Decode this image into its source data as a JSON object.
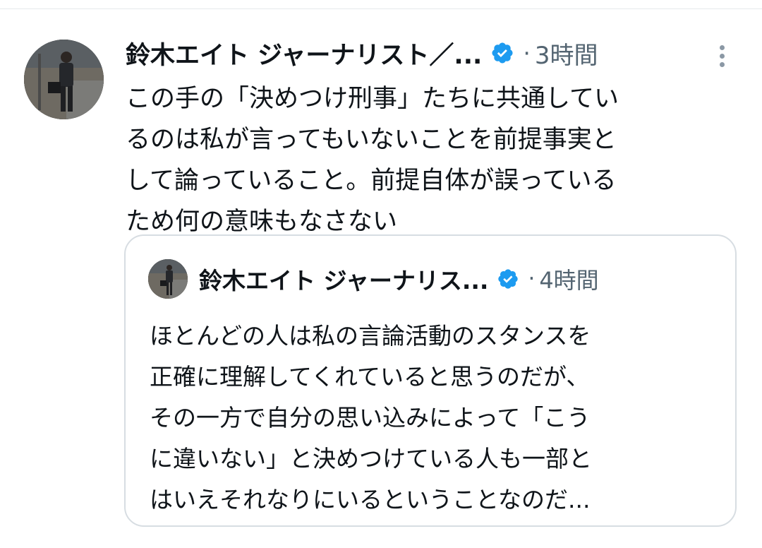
{
  "tweet": {
    "author": {
      "display_name": "鈴木エイト ジャーナリスト／...",
      "avatar_icon": "profile-photo",
      "verified": true
    },
    "separator": "·",
    "timestamp": "3時間",
    "more_icon": "more-vertical-icon",
    "text": "この手の「決めつけ刑事」たちに共通している\nるのは私が言ってもいないことを前提事実と\nして論っていること。前提自体が誤っている\nため何の意味もなさない",
    "text_lines": [
      "この手の「決めつけ刑事」たちに共通してい",
      "るのは私が言ってもいないことを前提事実と",
      "して論っていること。前提自体が誤っている",
      "ため何の意味もなさない"
    ],
    "quoted_tweet": {
      "author": {
        "display_name": "鈴木エイト ジャーナリス...",
        "verified": true
      },
      "separator": "·",
      "timestamp": "4時間",
      "text_lines": [
        "ほとんどの人は私の言論活動のスタンスを",
        "正確に理解してくれていると思うのだが、",
        "その一方で自分の思い込みによって「こう",
        "に違いない」と決めつけている人も一部と",
        "はいえそれなりにいるということなのだ..."
      ]
    }
  },
  "colors": {
    "text_primary": "#0f1419",
    "text_secondary": "#536471",
    "verified_blue": "#1d9bf0",
    "border": "#d7dde2"
  }
}
